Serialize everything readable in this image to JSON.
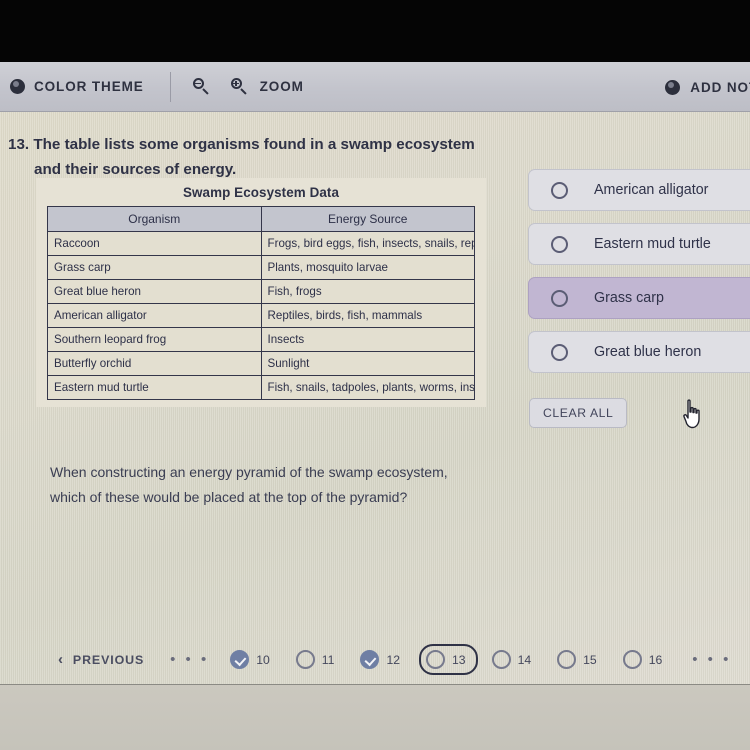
{
  "toolbar": {
    "color_theme_label": "COLOR THEME",
    "zoom_label": "ZOOM",
    "add_note_label": "ADD NOTE",
    "zoom_out_icon": "magnifier-minus-icon",
    "zoom_in_icon": "magnifier-plus-icon",
    "theme_icon": "color-theme-dot-icon",
    "note_icon": "add-note-dot-icon"
  },
  "question": {
    "number": "13.",
    "stem_line1": "The table lists some organisms found in a swamp ecosystem",
    "stem_line2": "and their sources of energy.",
    "sub_question": "When constructing an energy pyramid of the swamp ecosystem, which of these would be placed at the top of the pyramid?"
  },
  "table": {
    "title": "Swamp Ecosystem Data",
    "headers": [
      "Organism",
      "Energy Source"
    ],
    "rows": [
      [
        "Raccoon",
        "Frogs, bird eggs, fish, insects, snails, reptiles, plants"
      ],
      [
        "Grass carp",
        "Plants, mosquito larvae"
      ],
      [
        "Great blue heron",
        "Fish, frogs"
      ],
      [
        "American alligator",
        "Reptiles, birds, fish, mammals"
      ],
      [
        "Southern leopard frog",
        "Insects"
      ],
      [
        "Butterfly orchid",
        "Sunlight"
      ],
      [
        "Eastern mud turtle",
        "Fish, snails, tadpoles, plants, worms, insects"
      ]
    ]
  },
  "answers": {
    "options": [
      {
        "label": "American alligator",
        "selected": false,
        "hovered": false
      },
      {
        "label": "Eastern mud turtle",
        "selected": false,
        "hovered": false
      },
      {
        "label": "Grass carp",
        "selected": false,
        "hovered": true
      },
      {
        "label": "Great blue heron",
        "selected": false,
        "hovered": false
      }
    ],
    "clear_all_label": "CLEAR ALL"
  },
  "navigation": {
    "previous_label": "PREVIOUS",
    "ellipsis_left": "• • •",
    "ellipsis_right": "• • •",
    "pages": [
      {
        "number": "10",
        "status": "answered",
        "current": false
      },
      {
        "number": "11",
        "status": "unanswered",
        "current": false
      },
      {
        "number": "12",
        "status": "answered",
        "current": false
      },
      {
        "number": "13",
        "status": "unanswered",
        "current": true
      },
      {
        "number": "14",
        "status": "unanswered",
        "current": false
      },
      {
        "number": "15",
        "status": "unanswered",
        "current": false
      },
      {
        "number": "16",
        "status": "unanswered",
        "current": false
      }
    ]
  },
  "colors": {
    "paper_background": "#dcd9cb",
    "toolbar_background": "#c8c8d0",
    "hover_highlight": "#c1b6d2",
    "answered_bubble": "#6f7fa4",
    "text_primary": "#2f3249"
  }
}
